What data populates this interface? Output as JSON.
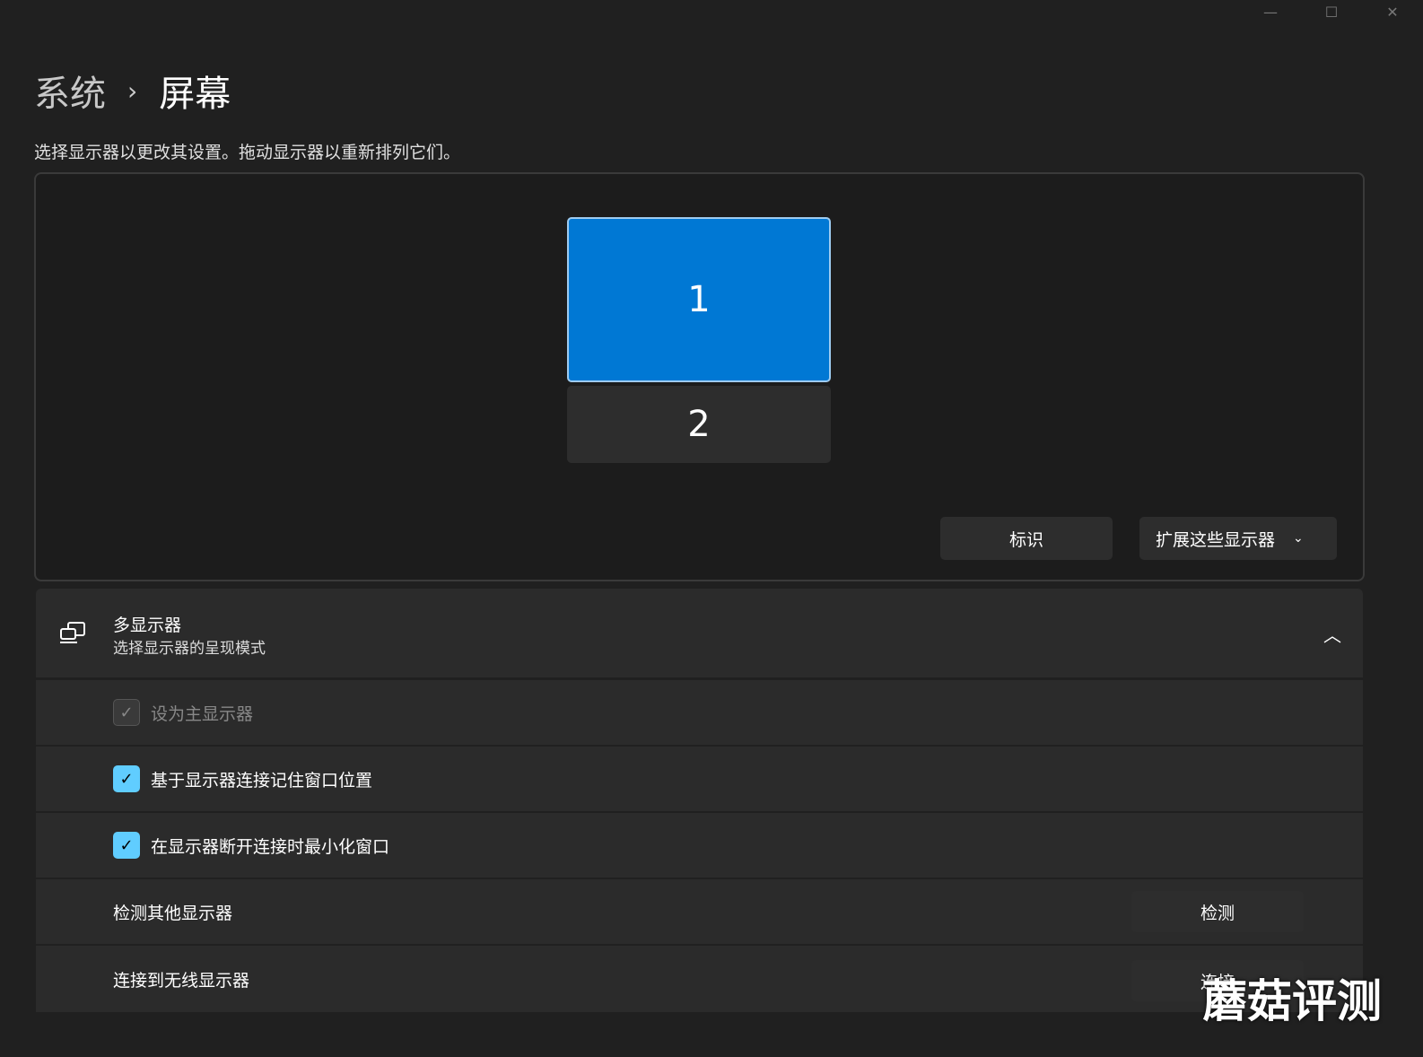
{
  "breadcrumb": {
    "parent": "系统",
    "current": "屏幕"
  },
  "description": "选择显示器以更改其设置。拖动显示器以重新排列它们。",
  "monitors": [
    "1",
    "2"
  ],
  "identify_label": "标识",
  "mode_label": "扩展这些显示器",
  "multi": {
    "title": "多显示器",
    "subtitle": "选择显示器的呈现模式"
  },
  "options": [
    {
      "label": "设为主显示器",
      "checked": true,
      "disabled": true
    },
    {
      "label": "基于显示器连接记住窗口位置",
      "checked": true
    },
    {
      "label": "在显示器断开连接时最小化窗口",
      "checked": true
    }
  ],
  "detect": {
    "label": "检测其他显示器",
    "button": "检测"
  },
  "wireless": {
    "label": "连接到无线显示器",
    "button": "连接"
  },
  "watermark": "蘑菇评测"
}
